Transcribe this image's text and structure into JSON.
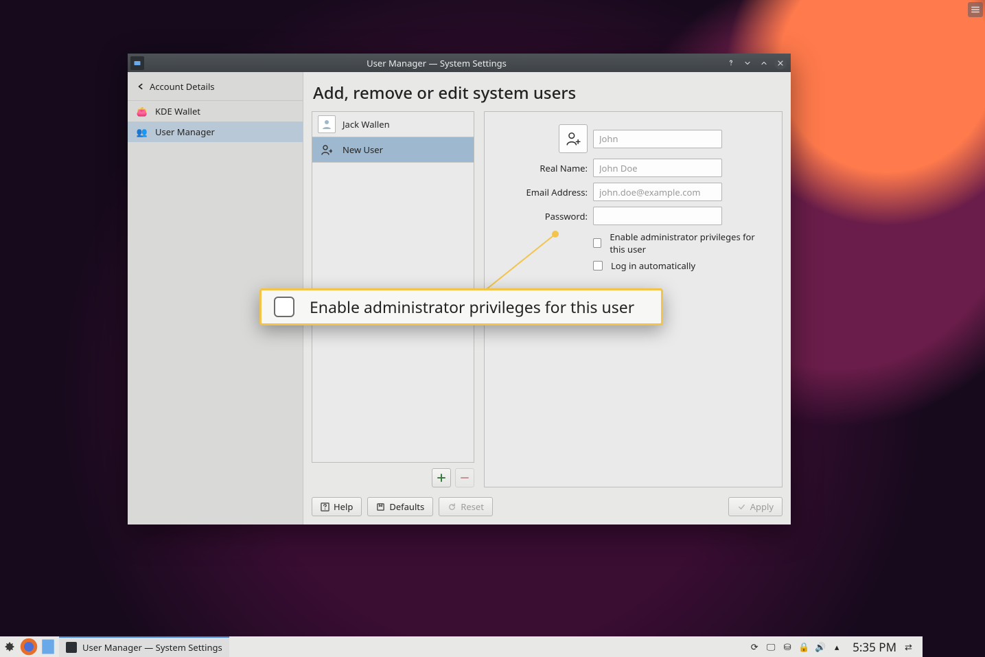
{
  "window": {
    "title": "User Manager — System Settings"
  },
  "sidebar": {
    "crumb": "Account Details",
    "items": [
      {
        "label": "KDE Wallet"
      },
      {
        "label": "User Manager"
      }
    ]
  },
  "main": {
    "title": "Add, remove or edit system users"
  },
  "users": [
    {
      "name": "Jack Wallen"
    },
    {
      "name": "New User"
    }
  ],
  "form": {
    "username_placeholder": "John",
    "realname_label": "Real Name:",
    "realname_placeholder": "John Doe",
    "email_label": "Email Address:",
    "email_placeholder": "john.doe@example.com",
    "password_label": "Password:",
    "admin_label": "Enable administrator privileges for this user",
    "autologin_label": "Log in automatically"
  },
  "buttons": {
    "help": "Help",
    "defaults": "Defaults",
    "reset": "Reset",
    "apply": "Apply"
  },
  "callout": {
    "text": "Enable administrator privileges for this user"
  },
  "taskbar": {
    "task": "User Manager  — System Settings",
    "clock": "5:35 PM"
  }
}
